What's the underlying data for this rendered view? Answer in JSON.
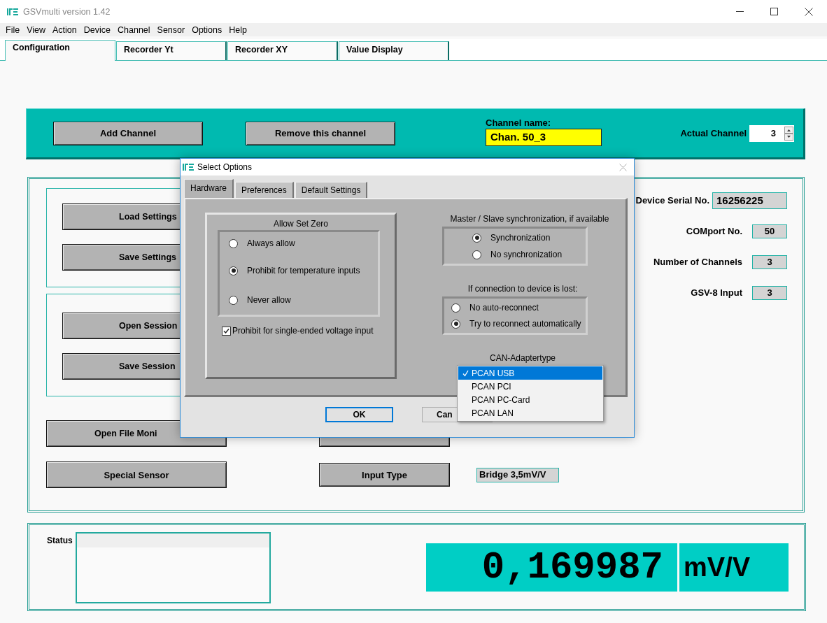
{
  "window": {
    "title": "GSVmulti version 1.42"
  },
  "menu": [
    "File",
    "View",
    "Action",
    "Device",
    "Channel",
    "Sensor",
    "Options",
    "Help"
  ],
  "tabs": [
    {
      "label": "Configuration",
      "selected": true
    },
    {
      "label": "Recorder Yt",
      "selected": false
    },
    {
      "label": "Recorder XY",
      "selected": false
    },
    {
      "label": "Value Display",
      "selected": false
    }
  ],
  "channel_bar": {
    "buttons": [
      "Add Channel",
      "Remove this channel"
    ],
    "channel_name_label": "Channel name:",
    "channel_name": "Chan. 50_3",
    "actual_channel_label": "Actual Channel",
    "actual_channel": "3"
  },
  "settings_buttons": [
    "Load Settings",
    "Save Settings"
  ],
  "session_buttons": [
    "Open Session",
    "Save Session"
  ],
  "device_info": [
    {
      "label": "Device Serial No.",
      "value": "16256225"
    },
    {
      "label": "COMport No.",
      "value": "50"
    },
    {
      "label": "Number of Channels",
      "value": "3"
    },
    {
      "label": "GSV-8 Input",
      "value": "3"
    }
  ],
  "file_monitor_button": "Open File Moni",
  "special_sensor_button": "Special Sensor",
  "input_type": {
    "button": "Input Type",
    "value": "Bridge 3,5mV/V"
  },
  "status": {
    "label": "Status"
  },
  "reading": {
    "value": "0,169987",
    "unit": "mV/V"
  },
  "dialog": {
    "title": "Select Options",
    "tabs": [
      {
        "label": "Hardware",
        "selected": true
      },
      {
        "label": "Preferences",
        "selected": false
      },
      {
        "label": "Default Settings",
        "selected": false
      }
    ],
    "allow_set_zero": {
      "title": "Allow Set Zero",
      "options": [
        {
          "label": "Always allow",
          "selected": false
        },
        {
          "label": "Prohibit for temperature inputs",
          "selected": true
        },
        {
          "label": "Never allow",
          "selected": false
        }
      ]
    },
    "single_ended": {
      "label": "Prohibit for single-ended voltage input",
      "checked": true
    },
    "sync": {
      "title": "Master / Slave synchronization, if available",
      "options": [
        {
          "label": "Synchronization",
          "selected": true
        },
        {
          "label": "No synchronization",
          "selected": false
        }
      ]
    },
    "connection_lost": {
      "title": "If connection to device is lost:",
      "options": [
        {
          "label": "No auto-reconnect",
          "selected": false
        },
        {
          "label": "Try to reconnect automatically",
          "selected": true
        }
      ]
    },
    "can_adapter": {
      "label": "CAN-Adaptertype",
      "options": [
        {
          "label": "PCAN USB",
          "selected": true
        },
        {
          "label": "PCAN PCI",
          "selected": false
        },
        {
          "label": "PCAN PC-Card",
          "selected": false
        },
        {
          "label": "PCAN LAN",
          "selected": false
        }
      ]
    },
    "buttons": [
      "OK",
      "Can"
    ]
  }
}
